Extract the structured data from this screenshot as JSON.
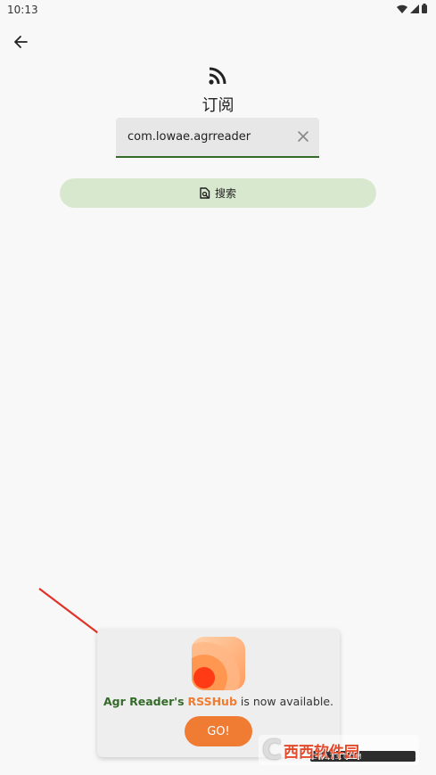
{
  "status_bar": {
    "time": "10:13"
  },
  "header": {
    "back_icon": "arrow-left-icon"
  },
  "page": {
    "icon": "rss-icon",
    "title": "订阅",
    "input_value": "com.lowae.agrreader",
    "clear_icon": "close-icon",
    "search_icon": "search-doc-icon",
    "search_label": "搜索"
  },
  "toast": {
    "text_part1": "Agr Reader's",
    "text_part2": "RSSHub",
    "text_part3": "is now available.",
    "go_label": "GO!"
  },
  "watermark": {
    "main": "西西软件园",
    "sub": "CR173.COM"
  },
  "colors": {
    "accent_green": "#356b2a",
    "button_green_bg": "#d8e8cf",
    "accent_orange": "#f07b33",
    "background": "#f8f8f8"
  }
}
